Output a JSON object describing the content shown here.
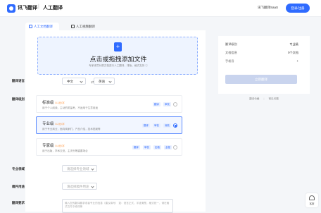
{
  "header": {
    "brand": "讯飞翻译",
    "separator": "|",
    "brand_sub": "人工翻译",
    "saas_link": "讯飞翻译SaaS",
    "login_button": "登录/注册",
    "accent_color": "#2f6bff"
  },
  "tabs": [
    {
      "label": "人工文档翻译",
      "icon": "document-icon",
      "active": true
    },
    {
      "label": "人工视频翻译",
      "icon": "video-icon",
      "active": false
    }
  ],
  "upload": {
    "title": "点击或拖拽添加文件",
    "hint": "专家译员对原文档进行人工翻译，排版，格式支持 ⓘ"
  },
  "form": {
    "language_label": "翻译语言",
    "source_lang": "中文",
    "swap_icon": "swap-icon",
    "target_lang": "英语",
    "level_label": "翻译级别",
    "field_label": "专业领域",
    "field_placeholder": "请选择专业领域",
    "purpose_label": "稿件用途",
    "purpose_placeholder": "请选择稿件用途",
    "requirement_label": "翻译要求",
    "requirement_placeholder": "输入您的翻译要求或者专业的信息（建议填写）\n如：语言正式，字迹清楚，格式统一，请在格式文件中修改等"
  },
  "levels": [
    {
      "name": "标准级",
      "price": "0.1元/字",
      "desc": "用于个人阅读，主动的质量考，不适用于生意用途",
      "chips": [
        "翻译",
        "审校"
      ],
      "selected": false
    },
    {
      "name": "专业级",
      "price": "0.2元/字",
      "desc": "用于专业商业，面向商家们，产品介绍，技术档案等",
      "chips": [
        "翻译",
        "审校",
        "润校"
      ],
      "selected": true
    },
    {
      "name": "专家级",
      "price": "0.4元/字",
      "desc": "用于出版，学术交流，主流刊等重要场合",
      "chips": [
        "翻译",
        "审校",
        "定稿",
        "全程"
      ],
      "selected": false
    }
  ],
  "summary": {
    "rows": [
      {
        "label": "翻译级别",
        "value": "专业级"
      },
      {
        "label": "文档信息",
        "value": "0个文档"
      },
      {
        "label": "手机号",
        "value": "+"
      }
    ],
    "submit_button": "立即翻译"
  },
  "side_links": [
    "翻译价格",
    "|",
    "常见问题"
  ],
  "float_bar": {
    "label": "客服",
    "icon": "headset-icon"
  }
}
